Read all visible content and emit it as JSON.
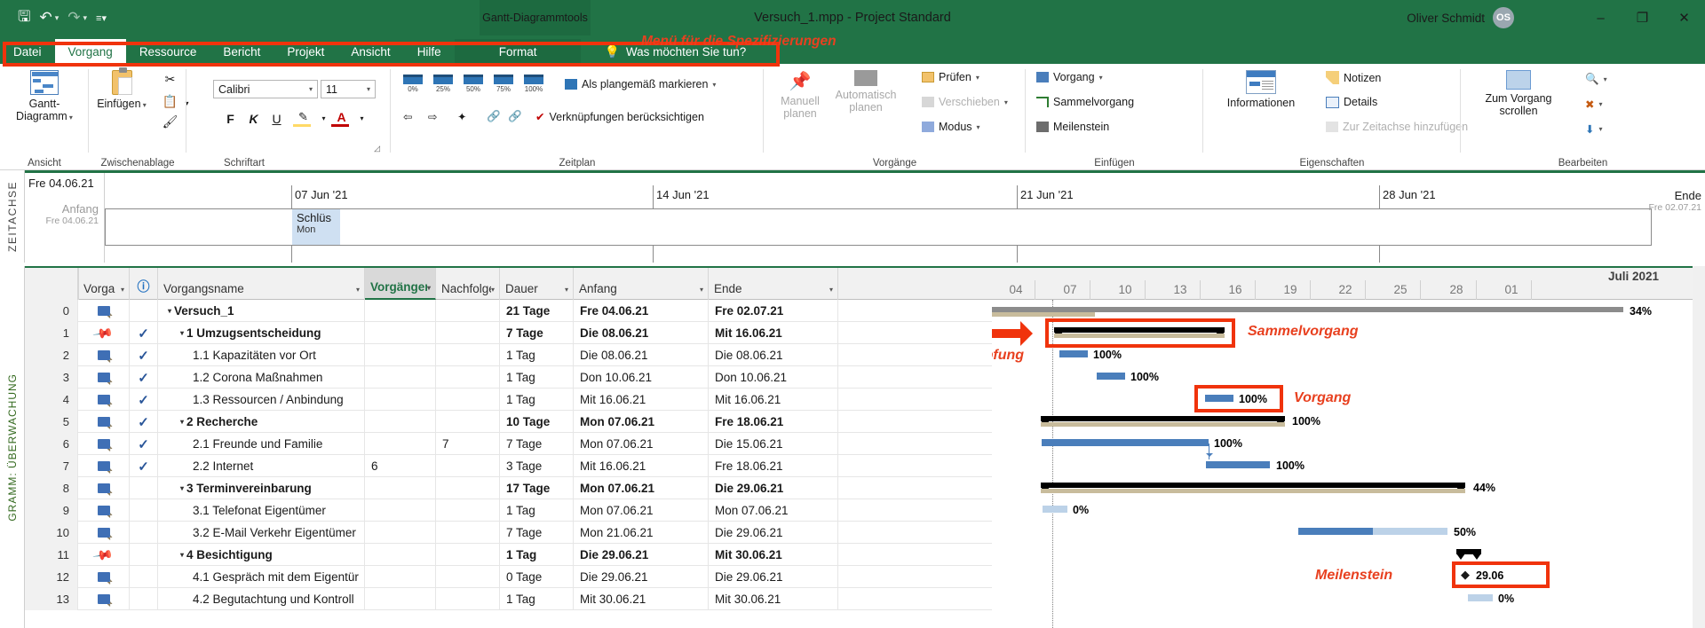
{
  "titlebar": {
    "save_icon": "save-icon",
    "undo_icon": "undo-icon",
    "redo_icon": "redo-icon",
    "customize_icon": "customize-quick-access-icon",
    "context_tools": "Gantt-Diagrammtools",
    "document_title": "Versuch_1.mpp  -  Project Standard",
    "user_name": "Oliver Schmidt",
    "user_initials": "OS",
    "minimize": "–",
    "restore": "❐",
    "close": "✕"
  },
  "tabs": {
    "items": [
      {
        "label": "Datei",
        "active": false
      },
      {
        "label": "Vorgang",
        "active": true
      },
      {
        "label": "Ressource",
        "active": false
      },
      {
        "label": "Bericht",
        "active": false
      },
      {
        "label": "Projekt",
        "active": false
      },
      {
        "label": "Ansicht",
        "active": false
      },
      {
        "label": "Hilfe",
        "active": false
      }
    ],
    "format_tab": "Format",
    "tell_me": "Was möchten Sie tun?",
    "annotation": "Menü für die Spezifizierungen"
  },
  "ribbon": {
    "groups": [
      {
        "name": "Ansicht",
        "label": "Ansicht"
      },
      {
        "name": "Zwischenablage",
        "label": "Zwischenablage"
      },
      {
        "name": "Schriftart",
        "label": "Schriftart"
      },
      {
        "name": "Zeitplan",
        "label": "Zeitplan"
      },
      {
        "name": "Vorgänge",
        "label": "Vorgänge"
      },
      {
        "name": "Einfügen",
        "label": "Einfügen"
      },
      {
        "name": "Eigenschaften",
        "label": "Eigenschaften"
      },
      {
        "name": "Bearbeiten",
        "label": "Bearbeiten"
      }
    ],
    "view": {
      "gantt_label_1": "Gantt-",
      "gantt_label_2": "Diagramm"
    },
    "clipboard": {
      "paste_label": "Einfügen"
    },
    "font": {
      "family": "Calibri",
      "size": "11",
      "bold": "F",
      "italic": "K",
      "underline": "U",
      "fill": "A-fill",
      "color": "A"
    },
    "schedule": {
      "pct": [
        "0%",
        "25%",
        "50%",
        "75%",
        "100%"
      ],
      "mark_on_track": "Als plangemäß markieren",
      "respect_links": "Verknüpfungen berücksichtigen"
    },
    "tasks": {
      "manual_1": "Manuell",
      "manual_2": "planen",
      "auto_1": "Automatisch",
      "auto_2": "planen",
      "inspect": "Prüfen",
      "move": "Verschieben",
      "mode": "Modus"
    },
    "insert": {
      "task": "Vorgang",
      "summary": "Sammelvorgang",
      "milestone": "Meilenstein"
    },
    "properties": {
      "information": "Informationen",
      "notes": "Notizen",
      "details": "Details",
      "add_timeline": "Zur Zeitachse hinzufügen"
    },
    "editing": {
      "scroll_1": "Zum Vorgang",
      "scroll_2": "scrollen",
      "find": "find-icon",
      "clear": "clear-icon",
      "fill": "fill-icon"
    }
  },
  "timeline": {
    "side_label": "ZEITACHSE",
    "start_date_top": "Fre 04.06.21",
    "start_label": "Anfang",
    "start_date": "Fre 04.06.21",
    "end_label": "Ende",
    "end_date": "Fre 02.07.21",
    "ticks": [
      "07 Jun '21",
      "14 Jun '21",
      "21 Jun '21",
      "28 Jun '21"
    ],
    "task_name": "Schlüs",
    "task_sub": "Mon"
  },
  "sheet": {
    "side_label": "GRAMM: ÜBERWACHUNG",
    "columns": [
      {
        "label": "Vorga",
        "selected": false,
        "arrow": true
      },
      {
        "label": "",
        "icon": "info-icon",
        "selected": false,
        "arrow": false
      },
      {
        "label": "Vorgangsname",
        "selected": false,
        "arrow": true
      },
      {
        "label": "Vorgänger",
        "selected": true,
        "arrow": true
      },
      {
        "label": "Nachfolge",
        "selected": false,
        "arrow": true
      },
      {
        "label": "Dauer",
        "selected": false,
        "arrow": true
      },
      {
        "label": "Anfang",
        "selected": false,
        "arrow": true
      },
      {
        "label": "Ende",
        "selected": false,
        "arrow": true
      }
    ],
    "rows": [
      {
        "id": "0",
        "mode": "task-icon",
        "check": false,
        "pin": false,
        "indent": 0,
        "expand": true,
        "name": "Versuch_1",
        "pred": "",
        "succ": "",
        "dur": "21 Tage",
        "start": "Fre 04.06.21",
        "end": "Fre 02.07.21",
        "bold": true
      },
      {
        "id": "1",
        "mode": "pin-icon",
        "check": true,
        "pin": true,
        "indent": 1,
        "expand": true,
        "name": "1 Umzugsentscheidung",
        "pred": "",
        "succ": "",
        "dur": "7 Tage",
        "start": "Die 08.06.21",
        "end": "Mit 16.06.21",
        "bold": true
      },
      {
        "id": "2",
        "mode": "task-icon",
        "check": true,
        "pin": false,
        "indent": 2,
        "expand": false,
        "name": "1.1 Kapazitäten vor Ort",
        "pred": "",
        "succ": "",
        "dur": "1 Tag",
        "start": "Die 08.06.21",
        "end": "Die 08.06.21",
        "bold": false
      },
      {
        "id": "3",
        "mode": "task-icon",
        "check": true,
        "pin": false,
        "indent": 2,
        "expand": false,
        "name": "1.2 Corona Maßnahmen",
        "pred": "",
        "succ": "",
        "dur": "1 Tag",
        "start": "Don 10.06.21",
        "end": "Don 10.06.21",
        "bold": false
      },
      {
        "id": "4",
        "mode": "task-icon",
        "check": true,
        "pin": false,
        "indent": 2,
        "expand": false,
        "name": "1.3 Ressourcen / Anbindung",
        "pred": "",
        "succ": "",
        "dur": "1 Tag",
        "start": "Mit 16.06.21",
        "end": "Mit 16.06.21",
        "bold": false
      },
      {
        "id": "5",
        "mode": "task-icon",
        "check": true,
        "pin": false,
        "indent": 1,
        "expand": true,
        "name": "2 Recherche",
        "pred": "",
        "succ": "",
        "dur": "10 Tage",
        "start": "Mon 07.06.21",
        "end": "Fre 18.06.21",
        "bold": true
      },
      {
        "id": "6",
        "mode": "task-icon",
        "check": true,
        "pin": false,
        "indent": 2,
        "expand": false,
        "name": "2.1 Freunde und Familie",
        "pred": "",
        "succ": "7",
        "dur": "7 Tage",
        "start": "Mon 07.06.21",
        "end": "Die 15.06.21",
        "bold": false
      },
      {
        "id": "7",
        "mode": "task-icon",
        "check": true,
        "pin": false,
        "indent": 2,
        "expand": false,
        "name": "2.2 Internet",
        "pred": "6",
        "succ": "",
        "dur": "3 Tage",
        "start": "Mit 16.06.21",
        "end": "Fre 18.06.21",
        "bold": false
      },
      {
        "id": "8",
        "mode": "task-icon",
        "check": false,
        "pin": false,
        "indent": 1,
        "expand": true,
        "name": "3 Terminvereinbarung",
        "pred": "",
        "succ": "",
        "dur": "17 Tage",
        "start": "Mon 07.06.21",
        "end": "Die 29.06.21",
        "bold": true
      },
      {
        "id": "9",
        "mode": "task-icon",
        "check": false,
        "pin": false,
        "indent": 2,
        "expand": false,
        "name": "3.1 Telefonat Eigentümer",
        "pred": "",
        "succ": "",
        "dur": "1 Tag",
        "start": "Mon 07.06.21",
        "end": "Mon 07.06.21",
        "bold": false
      },
      {
        "id": "10",
        "mode": "task-icon",
        "check": false,
        "pin": false,
        "indent": 2,
        "expand": false,
        "name": "3.2 E-Mail Verkehr Eigentümer",
        "pred": "",
        "succ": "",
        "dur": "7 Tage",
        "start": "Mon 21.06.21",
        "end": "Die 29.06.21",
        "bold": false
      },
      {
        "id": "11",
        "mode": "pin-icon",
        "check": false,
        "pin": true,
        "indent": 1,
        "expand": true,
        "name": "4 Besichtigung",
        "pred": "",
        "succ": "",
        "dur": "1 Tag",
        "start": "Die 29.06.21",
        "end": "Mit 30.06.21",
        "bold": true
      },
      {
        "id": "12",
        "mode": "task-icon",
        "check": false,
        "pin": false,
        "indent": 2,
        "expand": false,
        "name": "4.1 Gespräch mit dem Eigentür",
        "pred": "",
        "succ": "",
        "dur": "0 Tage",
        "start": "Die 29.06.21",
        "end": "Die 29.06.21",
        "bold": false
      },
      {
        "id": "13",
        "mode": "task-icon",
        "check": false,
        "pin": false,
        "indent": 2,
        "expand": false,
        "name": "4.2 Begutachtung und Kontroll",
        "pred": "",
        "succ": "",
        "dur": "1 Tag",
        "start": "Mit 30.06.21",
        "end": "Mit 30.06.21",
        "bold": false
      }
    ]
  },
  "gantt": {
    "month_label": "Juli 2021",
    "day_ticks": [
      "04",
      "07",
      "10",
      "13",
      "16",
      "19",
      "22",
      "25",
      "28",
      "01"
    ],
    "bar_labels": [
      "34%",
      "100%",
      "100%",
      "100%",
      "100%",
      "100%",
      "100%",
      "44%",
      "0%",
      "50%",
      "29.06",
      "0%"
    ],
    "milestone_label": "29.06",
    "annotations": {
      "sammelvorgang": "Sammelvorgang",
      "verknuepfung": "Verknüpfung",
      "vorgang": "Vorgang",
      "meilenstein": "Meilenstein"
    }
  },
  "colors": {
    "brand_green": "#217346",
    "annotation_red": "#e8401f",
    "highlight_red": "#f0330c",
    "bar_blue": "#4a7ebb",
    "summary_tan": "#c8bc9c"
  }
}
